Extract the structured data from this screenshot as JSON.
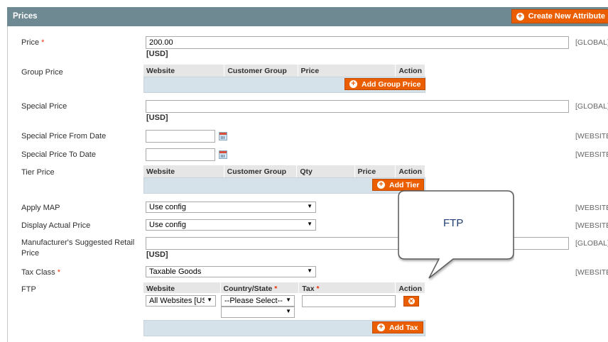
{
  "header": {
    "title": "Prices",
    "create_button": "Create New Attribute"
  },
  "scope": {
    "global": "[GLOBAL]",
    "website": "[WEBSITE]"
  },
  "currency": "[USD]",
  "price": {
    "label": "Price",
    "required": "*",
    "value": "200.00"
  },
  "group_price": {
    "label": "Group Price",
    "columns": [
      "Website",
      "Customer Group",
      "Price",
      "Action"
    ],
    "add_button": "Add Group Price"
  },
  "special_price": {
    "label": "Special Price",
    "value": ""
  },
  "special_from": {
    "label": "Special Price From Date"
  },
  "special_to": {
    "label": "Special Price To Date"
  },
  "tier_price": {
    "label": "Tier Price",
    "columns": [
      "Website",
      "Customer Group",
      "Qty",
      "Price",
      "Action"
    ],
    "add_button": "Add Tier"
  },
  "apply_map": {
    "label": "Apply MAP",
    "selected": "Use config"
  },
  "display_actual": {
    "label": "Display Actual Price",
    "selected": "Use config"
  },
  "msrp": {
    "label_line1": "Manufacturer's Suggested Retail",
    "label_line2": "Price"
  },
  "tax_class": {
    "label": "Tax Class",
    "required": "*",
    "selected": "Taxable Goods"
  },
  "ftp": {
    "label": "FTP",
    "columns": {
      "website": "Website",
      "country": "Country/State",
      "tax": "Tax",
      "action": "Action",
      "req": "*"
    },
    "row": {
      "website": "All Websites [US",
      "country": "--Please Select--",
      "state": "",
      "tax": ""
    },
    "add_button": "Add Tax"
  },
  "callout": {
    "text": "FTP"
  },
  "icons": {
    "add": "plus-circle-icon",
    "delete": "delete-circle-icon",
    "calendar": "calendar-icon",
    "dropdown": "chevron-down-icon"
  },
  "colors": {
    "header": "#6f8992",
    "button": "#eb5e00",
    "grid_footer": "#d6e2ea"
  }
}
